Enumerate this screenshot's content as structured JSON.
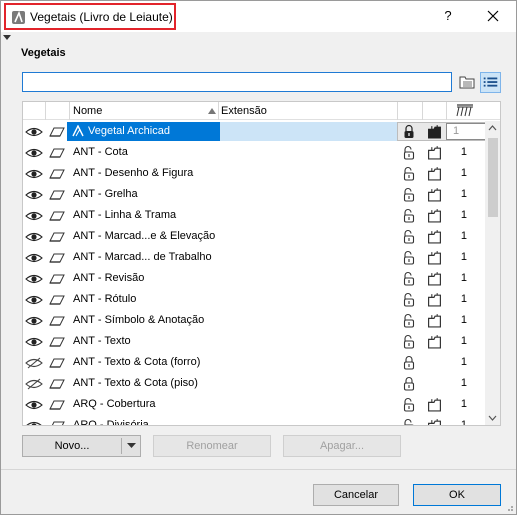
{
  "window": {
    "title": "Vegetais (Livro de Leiaute)",
    "help_label": "?",
    "highlight_color": "#e2242b"
  },
  "section_title": "Vegetais",
  "search": {
    "value": "",
    "placeholder": ""
  },
  "table": {
    "columns": {
      "name": "Nome",
      "extension": "Extensão"
    },
    "rows": [
      {
        "name": "Vegetal Archicad",
        "visible": true,
        "locked": true,
        "pen": "1",
        "selected": true
      },
      {
        "name": "ANT - Cota",
        "visible": true,
        "locked": false,
        "pen": "1"
      },
      {
        "name": "ANT - Desenho & Figura",
        "visible": true,
        "locked": false,
        "pen": "1"
      },
      {
        "name": "ANT - Grelha",
        "visible": true,
        "locked": false,
        "pen": "1"
      },
      {
        "name": "ANT - Linha & Trama",
        "visible": true,
        "locked": false,
        "pen": "1"
      },
      {
        "name": "ANT - Marcad...e & Elevação",
        "visible": true,
        "locked": false,
        "pen": "1"
      },
      {
        "name": "ANT - Marcad... de Trabalho",
        "visible": true,
        "locked": false,
        "pen": "1"
      },
      {
        "name": "ANT - Revisão",
        "visible": true,
        "locked": false,
        "pen": "1"
      },
      {
        "name": "ANT - Rótulo",
        "visible": true,
        "locked": false,
        "pen": "1"
      },
      {
        "name": "ANT - Símbolo & Anotação",
        "visible": true,
        "locked": false,
        "pen": "1"
      },
      {
        "name": "ANT - Texto",
        "visible": true,
        "locked": false,
        "pen": "1"
      },
      {
        "name": "ANT - Texto & Cota (forro)",
        "visible": false,
        "locked": true,
        "pen": "1"
      },
      {
        "name": "ANT - Texto & Cota (piso)",
        "visible": false,
        "locked": true,
        "pen": "1"
      },
      {
        "name": "ARQ - Cobertura",
        "visible": true,
        "locked": false,
        "pen": "1"
      },
      {
        "name": "ARQ - Divisória",
        "visible": true,
        "locked": false,
        "pen": "1"
      }
    ]
  },
  "buttons": {
    "new": "Novo...",
    "rename": "Renomear",
    "delete": "Apagar...",
    "cancel": "Cancelar",
    "ok": "OK"
  },
  "colors": {
    "selection": "#0078d7",
    "selection_light": "#cce4f7",
    "accent_border": "#1f7ad4"
  }
}
